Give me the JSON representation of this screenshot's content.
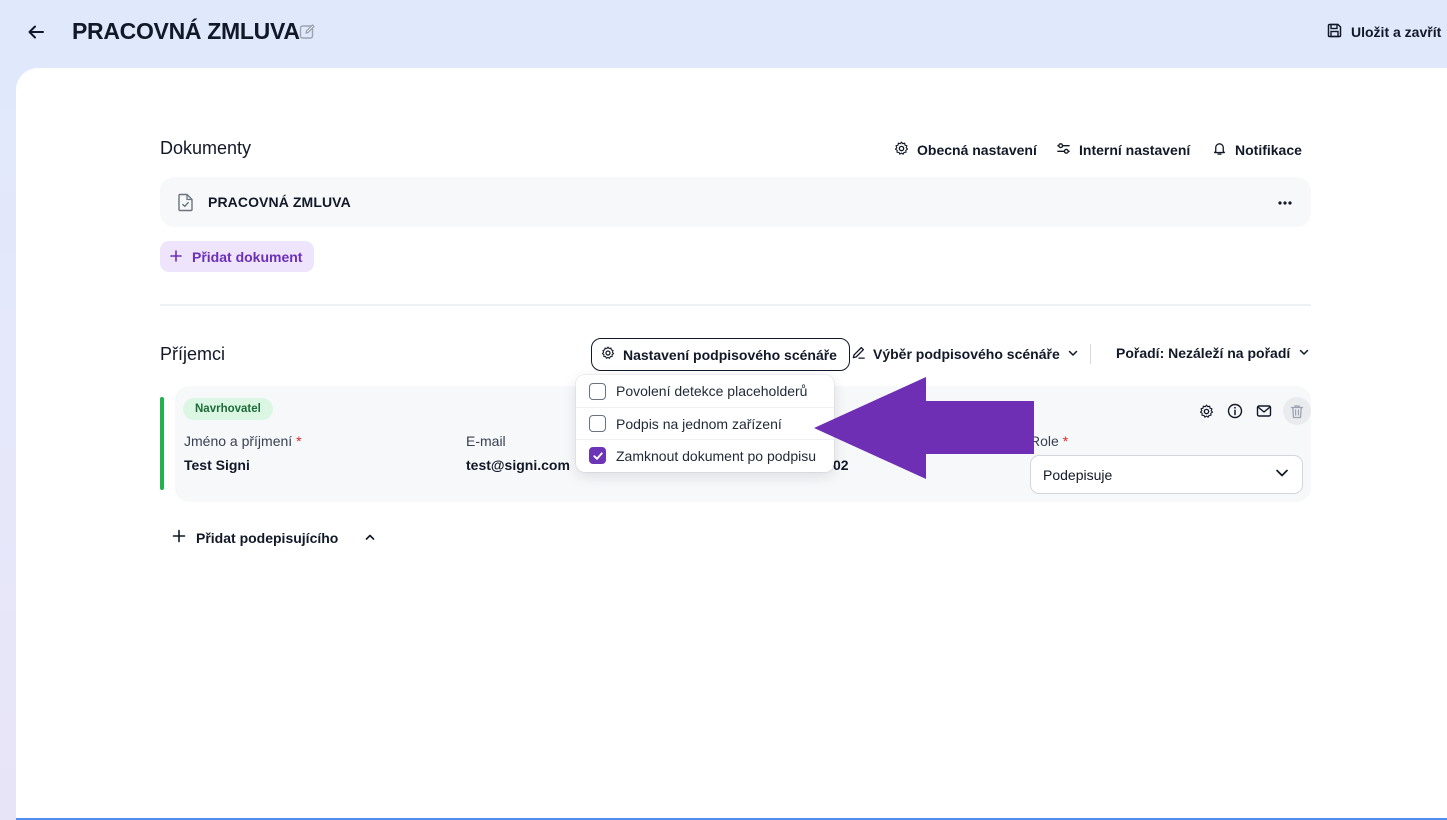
{
  "header": {
    "title": "PRACOVNÁ ZMLUVA",
    "save_close_label": "Uložit a zavřít"
  },
  "documents": {
    "title": "Dokumenty",
    "actions": {
      "general_settings": "Obecná nastavení",
      "internal_settings": "Interní nastavení",
      "notifications": "Notifikace"
    },
    "items": [
      {
        "name": "PRACOVNÁ ZMLUVA"
      }
    ],
    "add_label": "Přidat dokument"
  },
  "recipients": {
    "title": "Příjemci",
    "scenario_settings_label": "Nastavení podpisového scénáře",
    "scenario_select_label": "Výběr podpisového scénáře",
    "order_label": "Pořadí: Nezáleží na pořadí",
    "dropdown": {
      "options": [
        {
          "label": "Povolení detekce placeholderů",
          "checked": false
        },
        {
          "label": "Podpis na jednom zařízení",
          "checked": false
        },
        {
          "label": "Zamknout dokument po podpisu",
          "checked": true
        }
      ]
    },
    "list": [
      {
        "badge": "Navrhovatel",
        "name_label": "Jméno a příjmení",
        "name_value": "Test Signi",
        "email_label": "E-mail",
        "email_value": "test@signi.com",
        "phone_value_partial": "02",
        "role_label": "Role",
        "role_value": "Podepisuje"
      }
    ],
    "add_signer_label": "Přidat podepisujícího"
  },
  "colors": {
    "accent_purple": "#6b35b6",
    "annotation_arrow": "#6f2fb5",
    "active_border": "#23b04f"
  }
}
